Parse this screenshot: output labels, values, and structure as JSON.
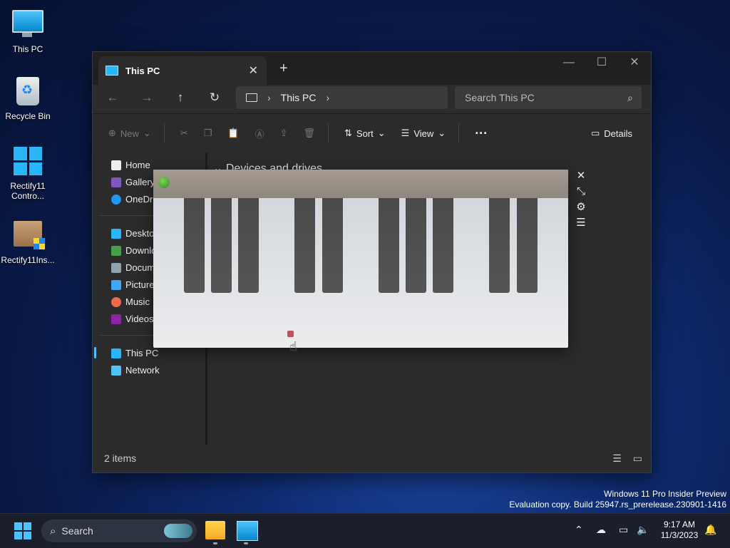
{
  "desktop": {
    "icons": [
      {
        "label": "This PC",
        "icon": "monitor-icon"
      },
      {
        "label": "Recycle Bin",
        "icon": "recycle-bin-icon"
      },
      {
        "label": "Rectify11 Contro...",
        "icon": "windows-tiles-icon"
      },
      {
        "label": "Rectify11Ins...",
        "icon": "installer-box-icon"
      }
    ]
  },
  "explorer": {
    "tab_title": "This PC",
    "address": {
      "location": "This PC"
    },
    "search_placeholder": "Search This PC",
    "toolbar": {
      "new_label": "New",
      "sort_label": "Sort",
      "view_label": "View",
      "details_label": "Details"
    },
    "sidebar": {
      "quick": [
        "Home",
        "Gallery",
        "OneDrive"
      ],
      "folders": [
        "Desktop",
        "Downloads",
        "Documents",
        "Pictures",
        "Music",
        "Videos"
      ],
      "locations": [
        "This PC",
        "Network"
      ]
    },
    "content": {
      "group_header": "Devices and drives"
    },
    "status": {
      "item_count": "2 items"
    }
  },
  "piano_app": {
    "black_key_count": 10
  },
  "watermark": {
    "line1": "Windows 11 Pro Insider Preview",
    "line2": "Evaluation copy. Build 25947.rs_prerelease.230901-1416"
  },
  "taskbar": {
    "search_label": "Search",
    "time": "9:17 AM",
    "date": "11/3/2023"
  },
  "colors": {
    "accent": "#4cc2ff",
    "explorer_bg": "#2b2b2b",
    "piano_titlebar": "#9b9189",
    "black_key": "#4f4f4f"
  }
}
